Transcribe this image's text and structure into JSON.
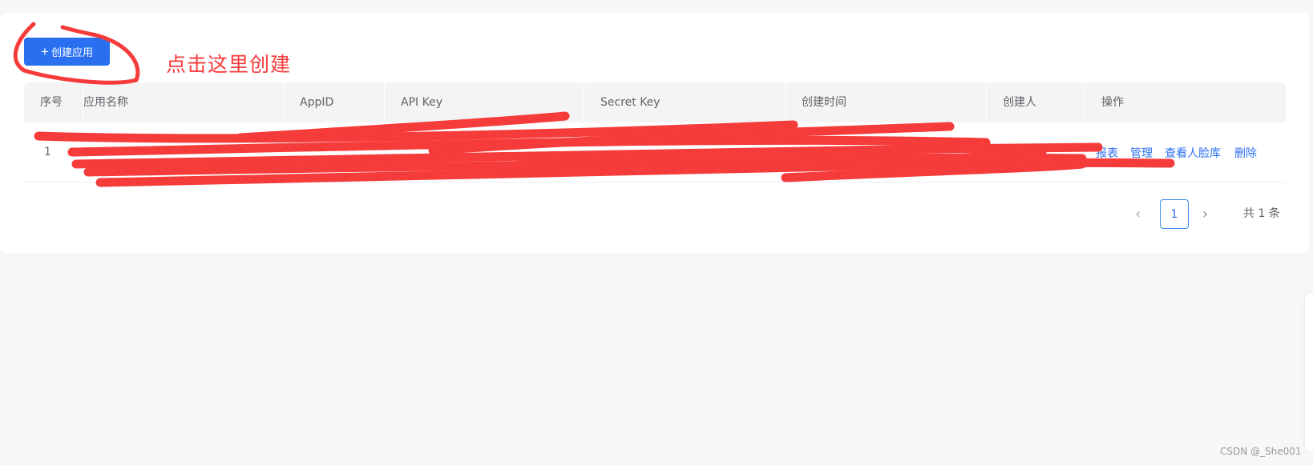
{
  "toolbar": {
    "create_label": "创建应用",
    "create_icon": "plus-icon"
  },
  "annotation": {
    "text": "点击这里创建",
    "color": "#f63b3b"
  },
  "table": {
    "columns": [
      "序号",
      "应用名称",
      "AppID",
      "API Key",
      "Secret Key",
      "创建时间",
      "创建人",
      "操作"
    ],
    "rows": [
      {
        "index": "1",
        "actions": [
          "报表",
          "管理",
          "查看人脸库",
          "删除"
        ]
      }
    ]
  },
  "pagination": {
    "prev_icon": "chevron-left-icon",
    "current": "1",
    "next_icon": "chevron-right-icon",
    "total": "共 1 条"
  },
  "watermark": "CSDN @_She001",
  "colors": {
    "primary": "#2a6ff0",
    "annotation": "#f63b3b",
    "header_bg": "#f4f4f5"
  }
}
